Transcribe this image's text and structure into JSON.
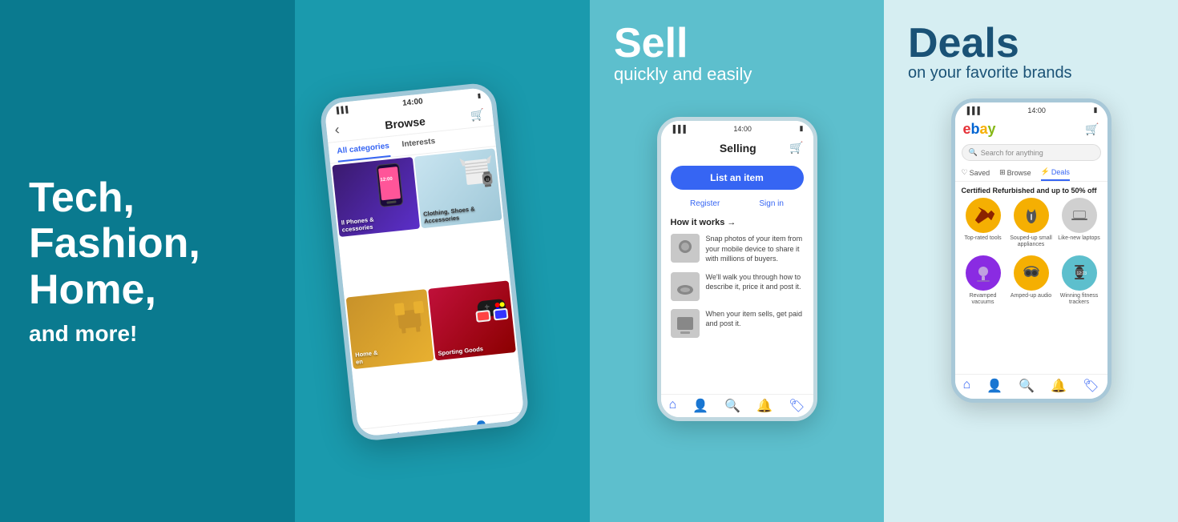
{
  "panel1": {
    "line1": "Tech,",
    "line2": "Fashion,",
    "line3": "Home,",
    "subtitle": "and more!"
  },
  "panel2": {
    "browse": {
      "title": "Browse",
      "tab_all": "All categories",
      "tab_interests": "Interests",
      "categories": [
        {
          "name": "ll Phones &\nccessories",
          "style": "cell-phones"
        },
        {
          "name": "Clothing, Shoes &\nAccessories",
          "style": "cell-clothing"
        },
        {
          "name": "Home &\nen",
          "style": "cell-home"
        },
        {
          "name": "Sporting Goods",
          "style": "cell-sporting"
        }
      ]
    }
  },
  "panel3": {
    "headline": "Sell",
    "subline": "quickly and easily",
    "selling": {
      "title": "Selling",
      "list_btn": "List an item",
      "register": "Register",
      "sign_in": "Sign in",
      "how_it_works": "How it works →",
      "steps": [
        {
          "text": "Snap photos of your item from your mobile device to share it with millions of buyers."
        },
        {
          "text": "We'll walk you through how to describe it, price it and post it."
        },
        {
          "text": "When your item sells, get paid and post it."
        }
      ]
    }
  },
  "panel4": {
    "headline": "Deals",
    "subline": "on your favorite brands",
    "deals": {
      "ebay_logo": "ebay",
      "search_placeholder": "Search for anything",
      "tabs": [
        {
          "label": "Saved",
          "icon": "♡",
          "active": false
        },
        {
          "label": "Browse",
          "icon": "⊞",
          "active": false
        },
        {
          "label": "Deals",
          "icon": "⚡",
          "active": true
        }
      ],
      "section_title": "Certified Refurbished and up to 50% off",
      "items_row1": [
        {
          "label": "Top-rated tools",
          "color": "yellow"
        },
        {
          "label": "Souped-up small appliances",
          "color": "yellow2"
        },
        {
          "label": "Like-new laptops",
          "color": "gray"
        }
      ],
      "items_row2": [
        {
          "label": "Revamped vacuums",
          "color": "purple"
        },
        {
          "label": "Amped-up audio",
          "color": "yellow2"
        },
        {
          "label": "Winning fitness trackers",
          "color": "teal"
        }
      ]
    }
  },
  "time": "14:00",
  "icons": {
    "back": "‹",
    "cart": "🛒",
    "home": "⌂",
    "person": "👤",
    "search": "🔍",
    "bell": "🔔",
    "tag": "🏷"
  }
}
